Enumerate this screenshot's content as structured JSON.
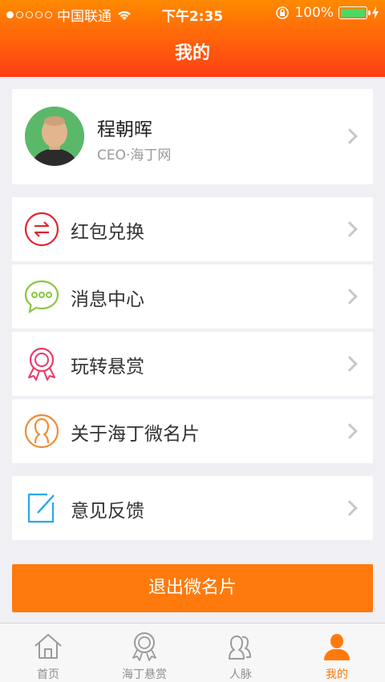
{
  "status_bar": {
    "carrier": "中国联通",
    "time": "下午2:35",
    "battery": "100%",
    "signal_bars_filled": 1,
    "signal_bars_total": 5
  },
  "header": {
    "title": "我的"
  },
  "profile": {
    "name": "程朝晖",
    "subtitle": "CEO·海丁网"
  },
  "menu": [
    {
      "label": "红包兑换",
      "icon": "exchange-icon",
      "color": "#e5242e"
    },
    {
      "label": "消息中心",
      "icon": "message-icon",
      "color": "#8cc63f"
    },
    {
      "label": "玩转悬赏",
      "icon": "award-icon",
      "color": "#e73c6b"
    },
    {
      "label": "关于海丁微名片",
      "icon": "person-icon",
      "color": "#f08c34"
    },
    {
      "label": "意见反馈",
      "icon": "edit-icon",
      "color": "#2aa8e0"
    }
  ],
  "logout_label": "退出微名片",
  "tabs": [
    {
      "label": "首页",
      "icon": "home-icon"
    },
    {
      "label": "海丁悬赏",
      "icon": "award-icon"
    },
    {
      "label": "人脉",
      "icon": "contacts-icon"
    },
    {
      "label": "我的",
      "icon": "user-icon"
    }
  ],
  "colors": {
    "accent": "#ff7a0c",
    "header_top": "#ff8a00",
    "header_bottom": "#ff3d14"
  }
}
